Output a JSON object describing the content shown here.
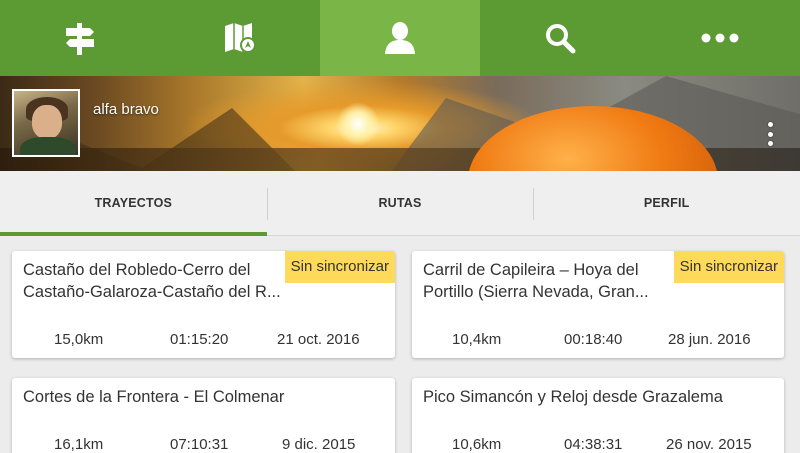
{
  "nav": {
    "items": [
      {
        "icon": "signpost-icon"
      },
      {
        "icon": "map-icon"
      },
      {
        "icon": "user-icon",
        "active": true
      },
      {
        "icon": "search-icon"
      },
      {
        "icon": "more-horizontal-icon"
      }
    ],
    "color": "#5c9a33",
    "active_color": "#7ab547"
  },
  "profile": {
    "username": "alfa bravo"
  },
  "tabs": [
    {
      "label": "TRAYECTOS",
      "active": true
    },
    {
      "label": "RUTAS"
    },
    {
      "label": "PERFIL"
    }
  ],
  "cards": [
    {
      "title": "Castaño del Robledo-Cerro del Castaño-Galaroza-Castaño del R...",
      "badge": "Sin sincronizar",
      "distance": "15,0km",
      "duration": "01:15:20",
      "date": "21 oct. 2016"
    },
    {
      "title": "Carril de Capileira – Hoya del Portillo (Sierra Nevada, Gran...",
      "badge": "Sin sincronizar",
      "distance": "10,4km",
      "duration": "00:18:40",
      "date": "28 jun. 2016"
    },
    {
      "title": "Cortes de la Frontera - El Colmenar",
      "distance": "16,1km",
      "duration": "07:10:31",
      "date": "9 dic. 2015"
    },
    {
      "title": "Pico Simancón y Reloj desde Grazalema",
      "distance": "10,6km",
      "duration": "04:38:31",
      "date": "26 nov. 2015"
    }
  ],
  "badge_color": "#ffd95a"
}
